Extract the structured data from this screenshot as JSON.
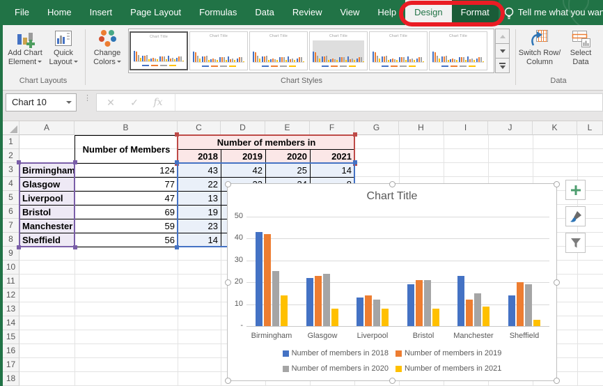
{
  "tab_bar": {
    "tabs": [
      {
        "label": "File"
      },
      {
        "label": "Home"
      },
      {
        "label": "Insert"
      },
      {
        "label": "Page Layout"
      },
      {
        "label": "Formulas"
      },
      {
        "label": "Data"
      },
      {
        "label": "Review"
      },
      {
        "label": "View"
      },
      {
        "label": "Help"
      },
      {
        "label": "Design",
        "state": "selected"
      },
      {
        "label": "Format",
        "state": "highlighted"
      }
    ],
    "tell_me": "Tell me what you want to"
  },
  "ribbon": {
    "add_chart_element": {
      "line1": "Add Chart",
      "line2": "Element"
    },
    "quick_layout": {
      "line1": "Quick",
      "line2": "Layout"
    },
    "change_colors": {
      "line1": "Change",
      "line2": "Colors"
    },
    "switch_row_column": {
      "line1": "Switch Row/",
      "line2": "Column"
    },
    "select_data": {
      "line1": "Select",
      "line2": "Data"
    },
    "group_labels": {
      "chart_layouts": "Chart Layouts",
      "chart_styles": "Chart Styles",
      "data": "Data"
    },
    "gallery": {
      "thumb_title": "Chart Title",
      "visible_thumbnails": 6,
      "selected_index": 0
    }
  },
  "formula_bar": {
    "name_box": "Chart 10",
    "formula": ""
  },
  "spreadsheet": {
    "column_letters": [
      "A",
      "B",
      "C",
      "D",
      "E",
      "F",
      "G",
      "H",
      "I",
      "J",
      "K",
      "L"
    ],
    "visible_rows": 18,
    "merged_header_b": "Number of Members",
    "merged_header_cf": "Number of members in",
    "year_headers": [
      "2018",
      "2019",
      "2020",
      "2021"
    ],
    "rows": [
      {
        "city": "Birmingham",
        "members_total": "124"
      },
      {
        "city": "Glasgow",
        "members_total": "77"
      },
      {
        "city": "Liverpool",
        "members_total": "47"
      },
      {
        "city": "Bristol",
        "members_total": "69"
      },
      {
        "city": "Manchester",
        "members_total": "59"
      },
      {
        "city": "Sheffield",
        "members_total": "56"
      }
    ]
  },
  "chart_data": {
    "type": "bar",
    "title": "Chart Title",
    "categories": [
      "Birmingham",
      "Glasgow",
      "Liverpool",
      "Bristol",
      "Manchester",
      "Sheffield"
    ],
    "series": [
      {
        "name": "Number of members in 2018",
        "color": "#4472C4",
        "values": [
          43,
          22,
          13,
          19,
          23,
          14
        ]
      },
      {
        "name": "Number of members in 2019",
        "color": "#ED7D31",
        "values": [
          42,
          23,
          14,
          21,
          12,
          20
        ]
      },
      {
        "name": "Number of members in 2020",
        "color": "#A5A5A5",
        "values": [
          25,
          24,
          12,
          21,
          15,
          19
        ]
      },
      {
        "name": "Number of members in 2021",
        "color": "#FFC000",
        "values": [
          14,
          8,
          8,
          8,
          9,
          3
        ]
      }
    ],
    "ylim": [
      0,
      50
    ],
    "yticks": [
      0,
      10,
      20,
      30,
      40,
      50
    ],
    "zero_tick_label": "-",
    "grid": true,
    "legend_position": "bottom"
  },
  "selection_colors": {
    "categories_range": "#7A5EA8",
    "series_names_range": "#BE4B48",
    "values_range": "#4472C4"
  },
  "annotation": {
    "shape": "red-oval",
    "color": "#EA1C24"
  }
}
